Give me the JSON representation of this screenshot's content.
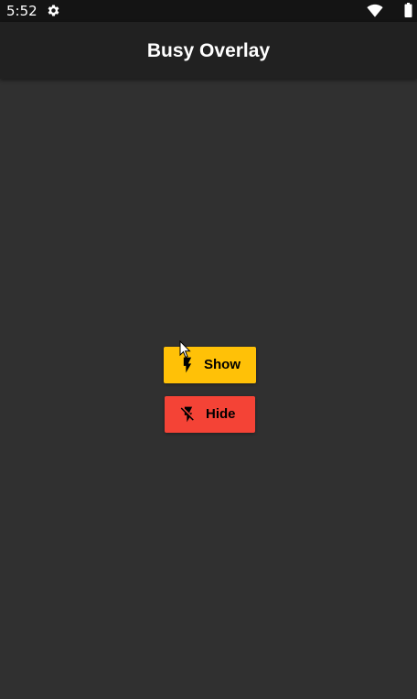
{
  "status_bar": {
    "time": "5:52",
    "icons": [
      "gear-icon",
      "wifi-icon",
      "battery-icon"
    ]
  },
  "app_bar": {
    "title": "Busy Overlay"
  },
  "buttons": {
    "show": {
      "label": "Show",
      "icon": "flash-on-icon",
      "color": "#ffc107"
    },
    "hide": {
      "label": "Hide",
      "icon": "flash-off-icon",
      "color": "#f44336"
    }
  },
  "colors": {
    "background": "#303030",
    "app_bar": "#212121",
    "status_bar": "#141414"
  }
}
